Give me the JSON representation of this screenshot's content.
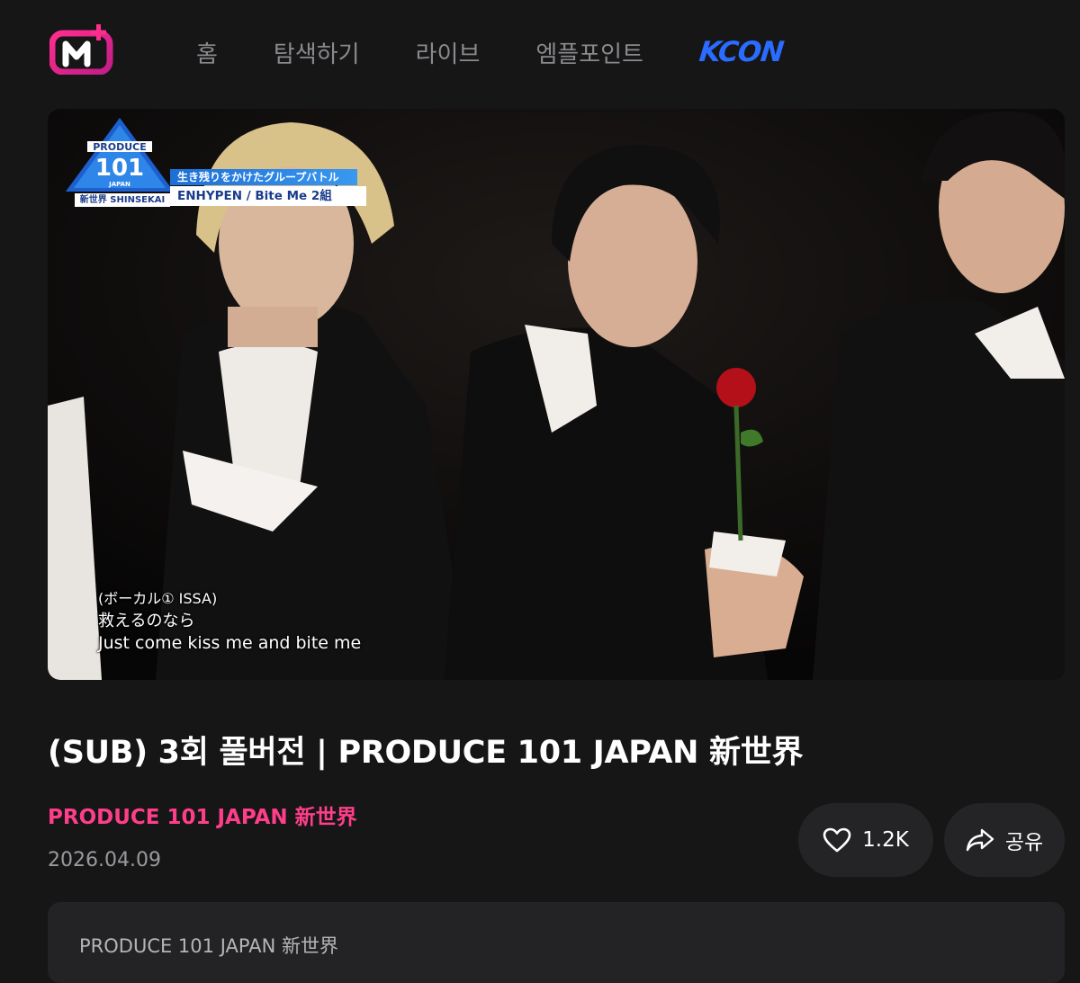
{
  "header": {
    "logo_text": "M+",
    "nav": [
      {
        "label": "홈"
      },
      {
        "label": "탐색하기"
      },
      {
        "label": "라이브"
      },
      {
        "label": "엠플포인트"
      }
    ],
    "kcon_label": "KCON"
  },
  "video": {
    "badge": {
      "produce": "PRODUCE",
      "number": "101",
      "japan": "JAPAN",
      "shinsekai": "新世界 SHINSEKAI",
      "line1": "生き残りをかけたグループバトル",
      "line2": "ENHYPEN / Bite Me  2組"
    },
    "subtitles": {
      "line1": "(ボーカル① ISSA)",
      "line2": "救えるのなら",
      "line3": "Just come kiss me and bite me"
    }
  },
  "title": "(SUB) 3회 풀버전 | PRODUCE 101 JAPAN 新世界",
  "channel": "PRODUCE 101 JAPAN 新世界",
  "date": "2026.04.09",
  "actions": {
    "like_count": "1.2K",
    "share_label": "공유"
  },
  "description": {
    "text": "PRODUCE 101 JAPAN 新世界"
  },
  "colors": {
    "background": "#161617",
    "accent_pink": "#ff3e8a",
    "kcon_blue": "#2a6cff",
    "pill_bg": "#242426"
  }
}
